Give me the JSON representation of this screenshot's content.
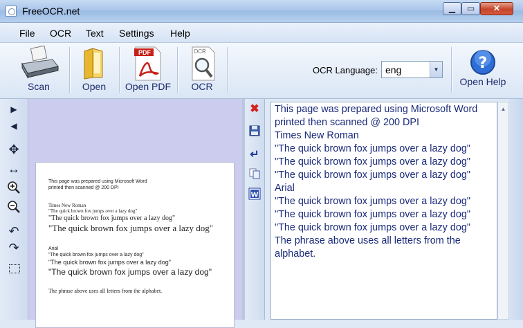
{
  "window": {
    "title": "FreeOCR.net"
  },
  "menu": [
    "File",
    "OCR",
    "Text",
    "Settings",
    "Help"
  ],
  "toolbar": {
    "scan": "Scan",
    "open": "Open",
    "open_pdf": "Open PDF",
    "ocr": "OCR",
    "open_help": "Open Help",
    "pdf_badge": "PDF",
    "ocr_badge": "OCR"
  },
  "ocr_language": {
    "label": "OCR Language:",
    "value": "eng"
  },
  "scanned_page": {
    "lines": [
      "This page was prepared using Microsoft Word",
      "printed then scanned @ 200 DPI",
      "Times New Roman",
      "\"The quick brown fox jumps over a lazy dog\"",
      "\"The quick brown fox jumps over a lazy dog\"",
      "\"The quick brown fox jumps over a lazy dog\"",
      "Arial",
      "\"The quick brown fox jumps over a lazy dog\"",
      "\"The quick brown fox  jumps over a lazy dog\"",
      "\"The quick brown fox jumps over a lazy dog\"",
      "The phrase above uses all letters from the alphabet."
    ]
  },
  "ocr_text": {
    "lines": [
      "This page was prepared using Microsoft Word",
      "printed then scanned @ 200 DPI",
      "Times New Roman",
      "\"The quick brown fox jumps over a lazy dog\"",
      "\"The quick brown fox jumps over a lazy dog\"",
      "\"The quick brown fox jumps over a lazy dog\"",
      "Arial",
      "\"The quick brown fox jumps over a lazy dog\"",
      "\"The quick brown fox jumps over a lazy dog\"",
      "\"The quick brown fox jumps over a lazy dog\"",
      "The phrase above uses all letters from the",
      "alphabet."
    ]
  },
  "icons": {
    "left_tools": [
      "arrow-right-icon",
      "arrow-left-icon",
      "move-icon",
      "fit-width-icon",
      "zoom-in-icon",
      "zoom-out-icon",
      "rotate-left-icon",
      "rotate-right-icon",
      "select-region-icon"
    ],
    "mid_tools": [
      "clear-icon",
      "save-icon",
      "enter-icon",
      "copy-icon",
      "word-icon"
    ]
  },
  "colors": {
    "viewer_bg": "#ccccee",
    "text_color": "#1a2a7a",
    "clear_red": "#d42020"
  }
}
